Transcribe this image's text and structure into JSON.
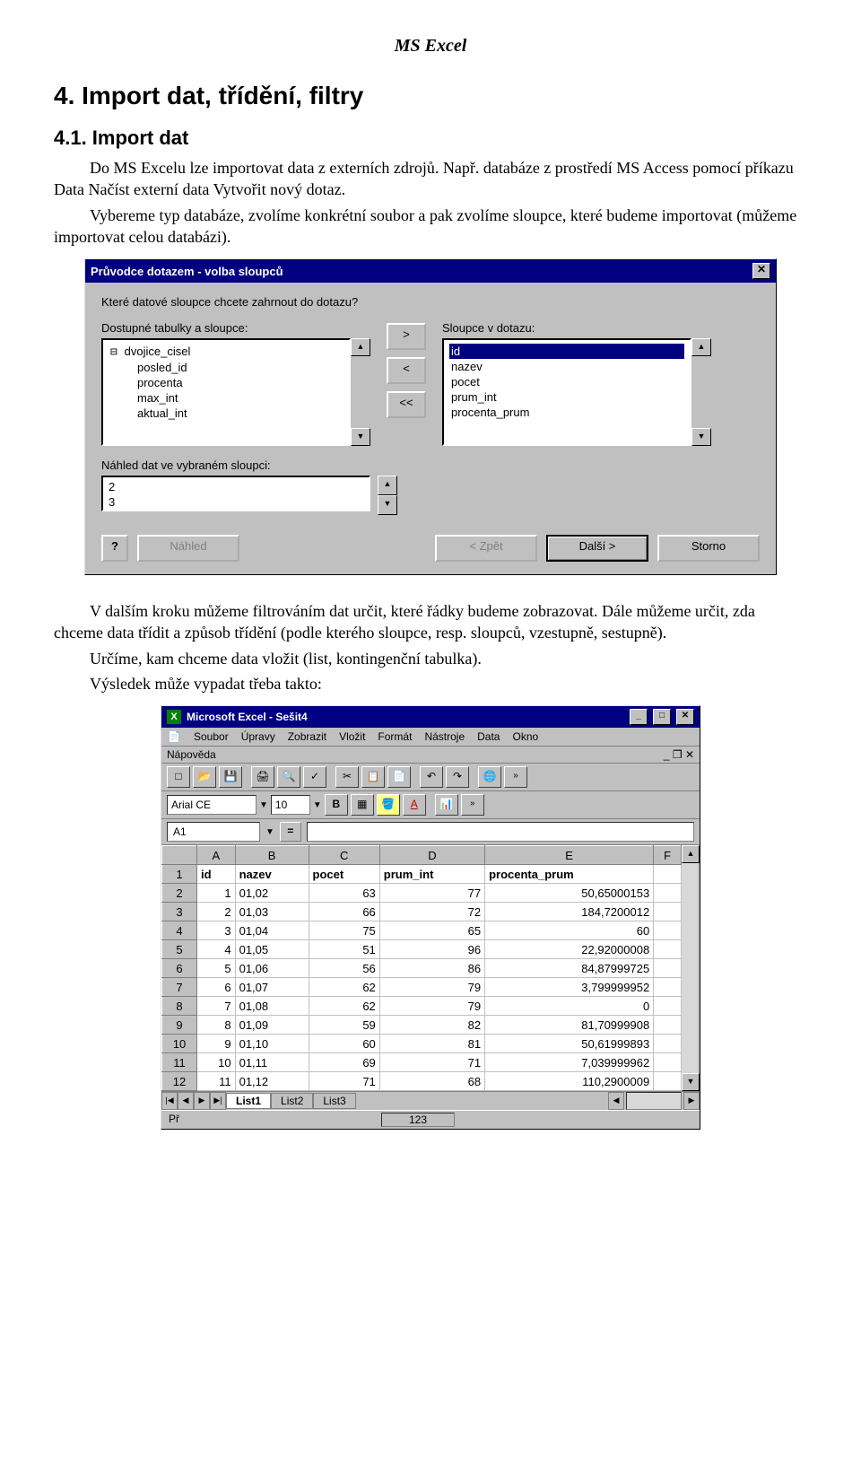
{
  "doc": {
    "header": "MS Excel",
    "h1": "4. Import dat, třídění, filtry",
    "h2": "4.1. Import dat",
    "p1": "Do MS Excelu lze importovat data z externích zdrojů. Např. databáze z prostředí MS Access pomocí příkazu Data Načíst externí data Vytvořit nový dotaz.",
    "p2": "Vybereme typ databáze, zvolíme konkrétní soubor a pak zvolíme sloupce, které budeme importovat (můžeme importovat celou databázi).",
    "p3": "V dalším kroku můžeme filtrováním dat určit, které řádky budeme zobrazovat. Dále můžeme určit, zda chceme data třídit a způsob třídění (podle kterého sloupce, resp. sloupců, vzestupně, sestupně).",
    "p4": "Určíme, kam chceme data vložit (list, kontingenční tabulka).",
    "p5": "Výsledek může vypadat třeba takto:"
  },
  "dialog": {
    "title": "Průvodce dotazem - volba sloupců",
    "question": "Které datové sloupce chcete zahrnout do dotazu?",
    "avail_label": "Dostupné tabulky a sloupce:",
    "query_label": "Sloupce v dotazu:",
    "avail_tree_root": "dvojice_cisel",
    "avail_items": [
      "posled_id",
      "procenta",
      "max_int",
      "aktual_int"
    ],
    "query_items": [
      "id",
      "nazev",
      "pocet",
      "prum_int",
      "procenta_prum"
    ],
    "preview_label": "Náhled dat ve vybraném sloupci:",
    "preview_vals": [
      "2",
      "3"
    ],
    "arrows": {
      "right": ">",
      "left": "<",
      "allleft": "<<"
    },
    "buttons": {
      "help": "?",
      "preview": "Náhled",
      "back": "< Zpět",
      "next": "Další >",
      "cancel": "Storno"
    }
  },
  "excel": {
    "title": "Microsoft Excel - Sešit4",
    "menus": [
      "Soubor",
      "Úpravy",
      "Zobrazit",
      "Vložit",
      "Formát",
      "Nástroje",
      "Data",
      "Okno"
    ],
    "help_menu": "Nápověda",
    "font_name": "Arial CE",
    "font_size": "10",
    "cell_ref": "A1",
    "columns": [
      "A",
      "B",
      "C",
      "D",
      "E",
      "F"
    ],
    "headers": [
      "id",
      "nazev",
      "pocet",
      "prum_int",
      "procenta_prum"
    ],
    "rows": [
      {
        "n": "1",
        "cells": [
          "id",
          "nazev",
          "pocet",
          "prum_int",
          "procenta_prum",
          ""
        ]
      },
      {
        "n": "2",
        "cells": [
          "1",
          "01,02",
          "63",
          "77",
          "50,65000153",
          ""
        ]
      },
      {
        "n": "3",
        "cells": [
          "2",
          "01,03",
          "66",
          "72",
          "184,7200012",
          ""
        ]
      },
      {
        "n": "4",
        "cells": [
          "3",
          "01,04",
          "75",
          "65",
          "60",
          ""
        ]
      },
      {
        "n": "5",
        "cells": [
          "4",
          "01,05",
          "51",
          "96",
          "22,92000008",
          ""
        ]
      },
      {
        "n": "6",
        "cells": [
          "5",
          "01,06",
          "56",
          "86",
          "84,87999725",
          ""
        ]
      },
      {
        "n": "7",
        "cells": [
          "6",
          "01,07",
          "62",
          "79",
          "3,799999952",
          ""
        ]
      },
      {
        "n": "8",
        "cells": [
          "7",
          "01,08",
          "62",
          "79",
          "0",
          ""
        ]
      },
      {
        "n": "9",
        "cells": [
          "8",
          "01,09",
          "59",
          "82",
          "81,70999908",
          ""
        ]
      },
      {
        "n": "10",
        "cells": [
          "9",
          "01,10",
          "60",
          "81",
          "50,61999893",
          ""
        ]
      },
      {
        "n": "11",
        "cells": [
          "10",
          "01,11",
          "69",
          "71",
          "7,039999962",
          ""
        ]
      },
      {
        "n": "12",
        "cells": [
          "11",
          "01,12",
          "71",
          "68",
          "110,2900009",
          ""
        ]
      }
    ],
    "sheet_tabs": [
      "List1",
      "List2",
      "List3"
    ],
    "status_left": "Př",
    "status_num": "123"
  }
}
